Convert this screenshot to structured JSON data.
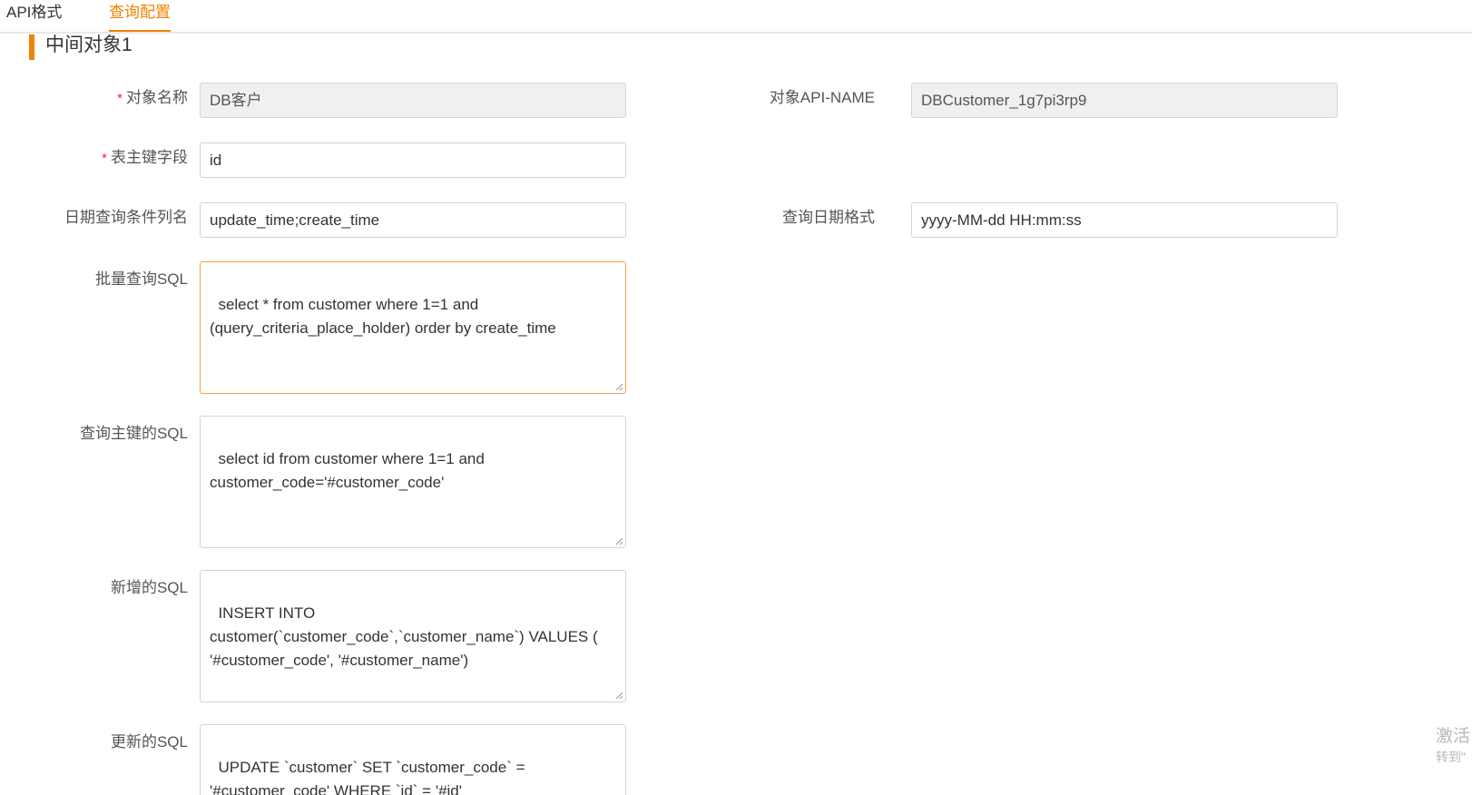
{
  "tabs": [
    {
      "label": "API格式"
    },
    {
      "label": "查询配置"
    }
  ],
  "section": {
    "title": "中间对象1"
  },
  "form": {
    "object_name": {
      "label": "对象名称",
      "required": "*",
      "value": "DB客户"
    },
    "object_api_name": {
      "label": "对象API-NAME",
      "value": "DBCustomer_1g7pi3rp9"
    },
    "primary_key": {
      "label": "表主键字段",
      "required": "*",
      "value": "id"
    },
    "date_columns": {
      "label": "日期查询条件列名",
      "value": "update_time;create_time"
    },
    "date_format": {
      "label": "查询日期格式",
      "value": "yyyy-MM-dd HH:mm:ss"
    },
    "batch_sql": {
      "label": "批量查询SQL",
      "value": "select * from customer where 1=1 and\n(query_criteria_place_holder) order by create_time"
    },
    "pk_sql": {
      "label": "查询主键的SQL",
      "value": "select id from customer where 1=1 and\ncustomer_code='#customer_code'"
    },
    "insert_sql": {
      "label": "新增的SQL",
      "value": "INSERT INTO\ncustomer(`customer_code`,`customer_name`) VALUES (\n'#customer_code', '#customer_name')"
    },
    "update_sql": {
      "label": "更新的SQL",
      "value": "UPDATE `customer` SET `customer_code` =\n'#customer_code' WHERE `id` = '#id'"
    }
  },
  "watermark": {
    "line1": "激活",
    "line2": "转到\""
  },
  "colors": {
    "accent": "#f08200",
    "required": "#f5222d",
    "border": "#d4d4d4",
    "disabled_bg": "#f0f0f0"
  }
}
